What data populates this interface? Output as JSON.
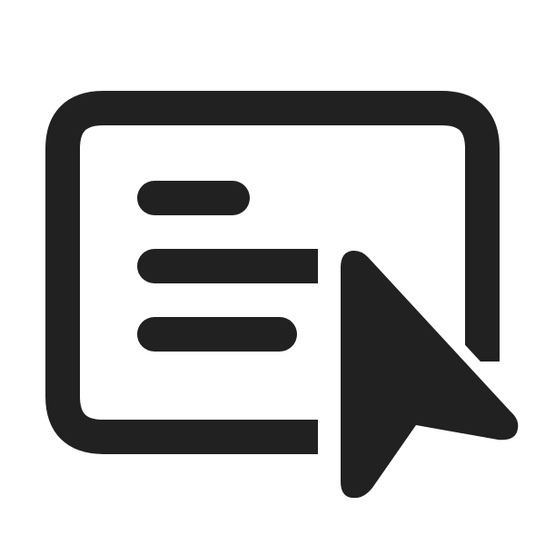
{
  "icon": {
    "name": "text-box-with-cursor-icon",
    "color": "#212121",
    "background": "#ffffff"
  }
}
